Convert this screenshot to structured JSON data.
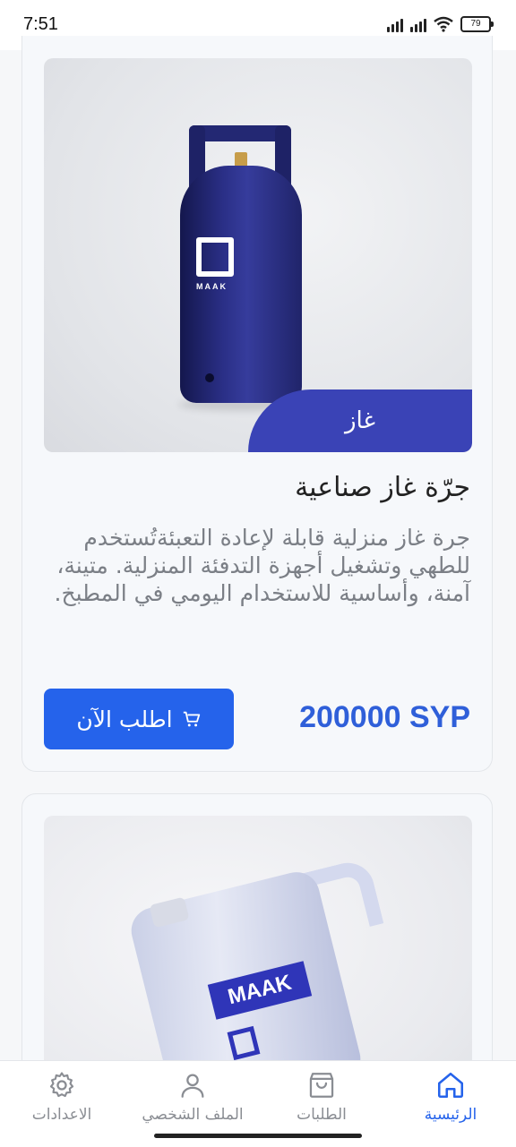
{
  "status_bar": {
    "time": "7:51",
    "battery": "79"
  },
  "products": [
    {
      "category": "غاز",
      "title": "جرّة غاز صناعية",
      "description": "جرة غاز منزلية قابلة لإعادة التعبئةتُستخدم للطهي وتشغيل أجهزة التدفئة المنزلية. متينة، آمنة، وأساسية للاستخدام اليومي في المطبخ.",
      "price": "200000 SYP",
      "order_label": "اطلب الآن",
      "image_brand": "MAAK"
    },
    {
      "image_brand": "MAAK"
    }
  ],
  "nav": {
    "home": "الرئيسية",
    "orders": "الطلبات",
    "profile": "الملف الشخصي",
    "settings": "الاعدادات"
  },
  "colors": {
    "accent": "#2563eb",
    "badge": "#3a43b6"
  }
}
